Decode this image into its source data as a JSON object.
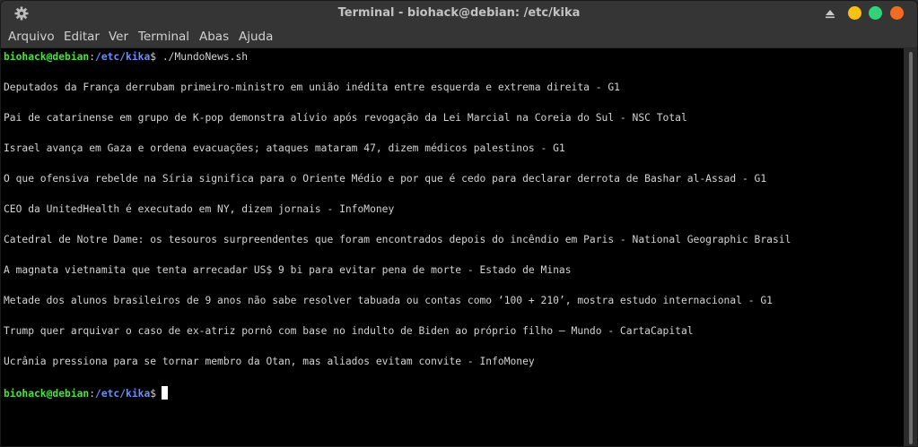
{
  "window": {
    "title": "Terminal - biohack@debian: /etc/kika",
    "icons": {
      "settings": "gear-icon",
      "shade": "chevron-up-icon"
    },
    "buttons": {
      "minimize_color": "#f5c211",
      "maximize_color": "#33d17a",
      "close_color": "#f26b21"
    }
  },
  "menu": {
    "items": [
      "Arquivo",
      "Editar",
      "Ver",
      "Terminal",
      "Abas",
      "Ajuda"
    ]
  },
  "prompt": {
    "user_host": "biohack@debian",
    "separator": ":",
    "path": "/etc/kika",
    "symbol": "$",
    "command": " ./MundoNews.sh"
  },
  "output": {
    "lines": [
      "Deputados da França derrubam primeiro-ministro em união inédita entre esquerda e extrema direita - G1",
      "Pai de catarinense em grupo de K-pop demonstra alívio após revogação da Lei Marcial na Coreia do Sul - NSC Total",
      "Israel avança em Gaza e ordena evacuações; ataques mataram 47, dizem médicos palestinos - G1",
      "O que ofensiva rebelde na Síria significa para o Oriente Médio e por que é cedo para declarar derrota de Bashar al-Assad - G1",
      "CEO da UnitedHealth é executado em NY, dizem jornais - InfoMoney",
      "Catedral de Notre Dame: os tesouros surpreendentes que foram encontrados depois do incêndio em Paris - National Geographic Brasil",
      "A magnata vietnamita que tenta arrecadar US$ 9 bi para evitar pena de morte - Estado de Minas",
      "Metade dos alunos brasileiros de 9 anos não sabe resolver tabuada ou contas como ‘100 + 210’, mostra estudo internacional - G1",
      "Trump quer arquivar o caso de ex-atriz pornô com base no indulto de Biden ao próprio filho – Mundo - CartaCapital",
      "Ucrânia pressiona para se tornar membro da Otan, mas aliados evitam convite - InfoMoney"
    ]
  },
  "colors": {
    "background": "#000000",
    "text": "#d3d3d3",
    "prompt_user": "#4ae23c",
    "prompt_path": "#6b8cff"
  }
}
